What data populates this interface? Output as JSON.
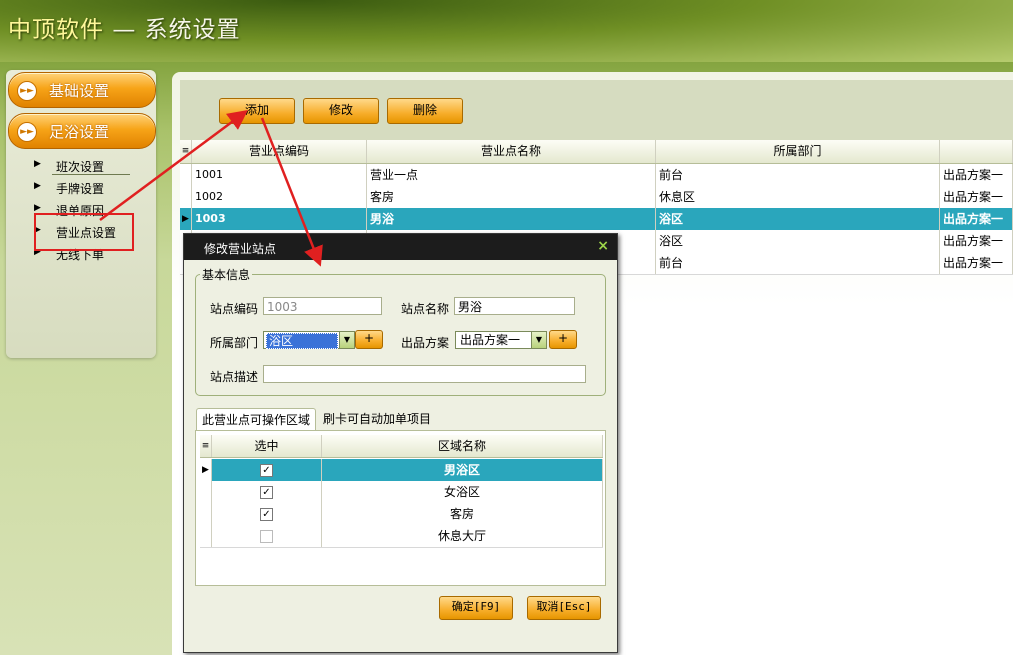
{
  "header": {
    "brand": "中顶软件",
    "separator": "—",
    "section": "系统设置"
  },
  "sidebar": {
    "groups": [
      {
        "label": "基础设置"
      },
      {
        "label": "足浴设置"
      }
    ],
    "items": [
      {
        "label": "班次设置"
      },
      {
        "label": "手牌设置"
      },
      {
        "label": "退单原因"
      },
      {
        "label": "营业点设置"
      },
      {
        "label": "无线下单"
      }
    ]
  },
  "toolbar": {
    "add_label": "添加",
    "edit_label": "修改",
    "delete_label": "删除"
  },
  "table": {
    "columns": [
      "营业点编码",
      "营业点名称",
      "所属部门",
      ""
    ],
    "rows": [
      {
        "code": "1001",
        "name": "营业一点",
        "dept": "前台",
        "plan": "出品方案一"
      },
      {
        "code": "1002",
        "name": "客房",
        "dept": "休息区",
        "plan": "出品方案一"
      },
      {
        "code": "1003",
        "name": "男浴",
        "dept": "浴区",
        "plan": "出品方案一"
      },
      {
        "code": "",
        "name": "",
        "dept": "浴区",
        "plan": "出品方案一"
      },
      {
        "code": "",
        "name": "",
        "dept": "前台",
        "plan": "出品方案一"
      }
    ]
  },
  "dialog": {
    "title": "修改营业站点",
    "close": "×",
    "fieldset_legend": "基本信息",
    "fields": {
      "code_label": "站点编码",
      "code_value": "1003",
      "name_label": "站点名称",
      "name_value": "男浴",
      "dept_label": "所属部门",
      "dept_value": "浴区",
      "plan_label": "出品方案",
      "plan_value": "出品方案一",
      "desc_label": "站点描述",
      "desc_value": "",
      "plus": "+"
    },
    "tabs": [
      {
        "label": "此营业点可操作区域"
      },
      {
        "label": "刷卡可自动加单项目"
      }
    ],
    "area_grid": {
      "columns": [
        "选中",
        "区域名称"
      ],
      "rows": [
        {
          "checked": true,
          "name": "男浴区"
        },
        {
          "checked": true,
          "name": "女浴区"
        },
        {
          "checked": true,
          "name": "客房"
        },
        {
          "checked": false,
          "name": "休息大厅"
        }
      ]
    },
    "ok_label": "确定[F9]",
    "cancel_label": "取消[Esc]"
  },
  "colors": {
    "accent": "#f7a418",
    "selected_row": "#2aa6bc",
    "annotation": "#e02020"
  }
}
